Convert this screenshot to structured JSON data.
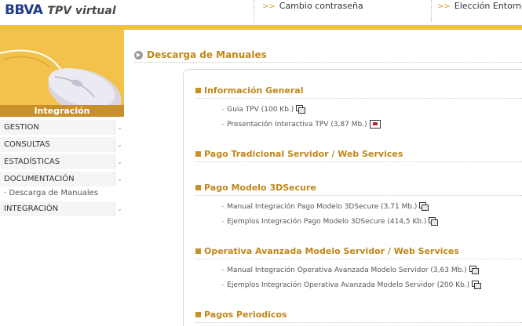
{
  "header": {
    "logo_brand": "BBVA",
    "logo_product": "TPV virtual",
    "links": [
      {
        "label": "Cambio contraseña"
      },
      {
        "label": "Elección Entorno"
      }
    ],
    "link_arrows": ">>",
    "accent_color": "#f0c040"
  },
  "sidebar": {
    "banner_title": "Integración",
    "items": [
      {
        "label": "GESTION"
      },
      {
        "label": "CONSULTAS"
      },
      {
        "label": "ESTADÍSTICAS"
      },
      {
        "label": "DOCUMENTACIÓN"
      },
      {
        "label": "INTEGRACIÓN"
      }
    ],
    "subitem": "· Descarga de Manuales",
    "chevron": "⌄"
  },
  "main": {
    "title": "Descarga de Manuales",
    "title_icon": "arrow-circle-icon",
    "sections": [
      {
        "title": "Información General",
        "items": [
          {
            "label": "Guia TPV (100 Kb.)",
            "icon": "document-icon"
          },
          {
            "label": "Presentación Interactiva TPV (3,87 Mb.)",
            "icon": "presentation-icon"
          }
        ]
      },
      {
        "title": "Pago Tradicional Servidor / Web Services",
        "items": []
      },
      {
        "title": "Pago Modelo 3DSecure",
        "items": [
          {
            "label": "Manual Integración Pago Modelo 3DSecure (3,71 Mb.)",
            "icon": "document-icon"
          },
          {
            "label": "Ejemplos Integración Pago Modelo 3DSecure (414,5 Kb.)",
            "icon": "document-icon"
          }
        ]
      },
      {
        "title": "Operativa Avanzada Modelo Servidor / Web Services",
        "items": [
          {
            "label": "Manual Integración Operativa Avanzada Modelo Servidor (3,63 Mb.)",
            "icon": "document-icon"
          },
          {
            "label": "Ejemplos Integración Operativa Avanzada Modelo Servidor (200 Kb.)",
            "icon": "document-icon"
          }
        ]
      },
      {
        "title": "Pagos Periodicos",
        "items": []
      }
    ],
    "item_dash": "-"
  }
}
